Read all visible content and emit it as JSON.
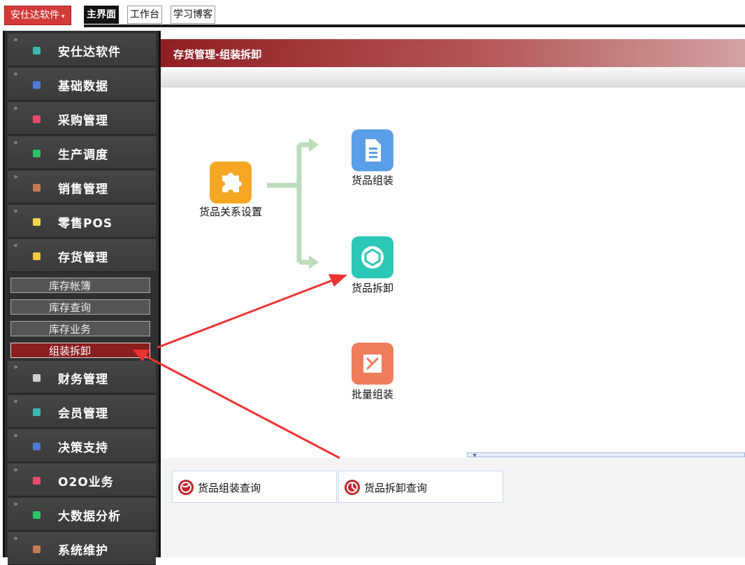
{
  "brand": {
    "label": "安仕达软件"
  },
  "top_tabs": [
    "主界面",
    "工作台",
    "学习博客"
  ],
  "sidebar": {
    "items": [
      {
        "label": "安仕达软件",
        "icon_color": "#3ab8b0"
      },
      {
        "label": "基础数据",
        "icon_color": "#4f7bd8"
      },
      {
        "label": "采购管理",
        "icon_color": "#e84a6e"
      },
      {
        "label": "生产调度",
        "icon_color": "#29c36a"
      },
      {
        "label": "销售管理",
        "icon_color": "#c77a52"
      },
      {
        "label": "零售POS",
        "icon_color": "#f3d54a"
      },
      {
        "label": "存货管理",
        "icon_color": "#f0c840"
      },
      {
        "label": "财务管理",
        "icon_color": "#cfcfcf"
      },
      {
        "label": "会员管理",
        "icon_color": "#3ab8b0"
      },
      {
        "label": "决策支持",
        "icon_color": "#4f7bd8"
      },
      {
        "label": "O2O业务",
        "icon_color": "#e84a6e"
      },
      {
        "label": "大数据分析",
        "icon_color": "#29c36a"
      },
      {
        "label": "系统维护",
        "icon_color": "#c77a52"
      }
    ],
    "sub_items": [
      "库存帐簿",
      "库存查询",
      "库存业务",
      "组装拆卸"
    ]
  },
  "main": {
    "title": "存货管理-组装拆卸",
    "flow": {
      "relation": {
        "label": "货品关系设置",
        "color": "#f5a623"
      },
      "assemble": {
        "label": "货品组装",
        "color": "#5b9ee8"
      },
      "disassemble": {
        "label": "货品拆卸",
        "color": "#2cc7b6"
      },
      "batch": {
        "label": "批量组装",
        "color": "#ee7d5c"
      }
    },
    "queries": [
      {
        "label": "货品组装查询",
        "icon_color": "#c0272d"
      },
      {
        "label": "货品拆卸查询",
        "icon_color": "#c0272d"
      }
    ]
  },
  "colors": {
    "accent": "#8f1e22",
    "annotation_arrow": "#ee3333"
  }
}
